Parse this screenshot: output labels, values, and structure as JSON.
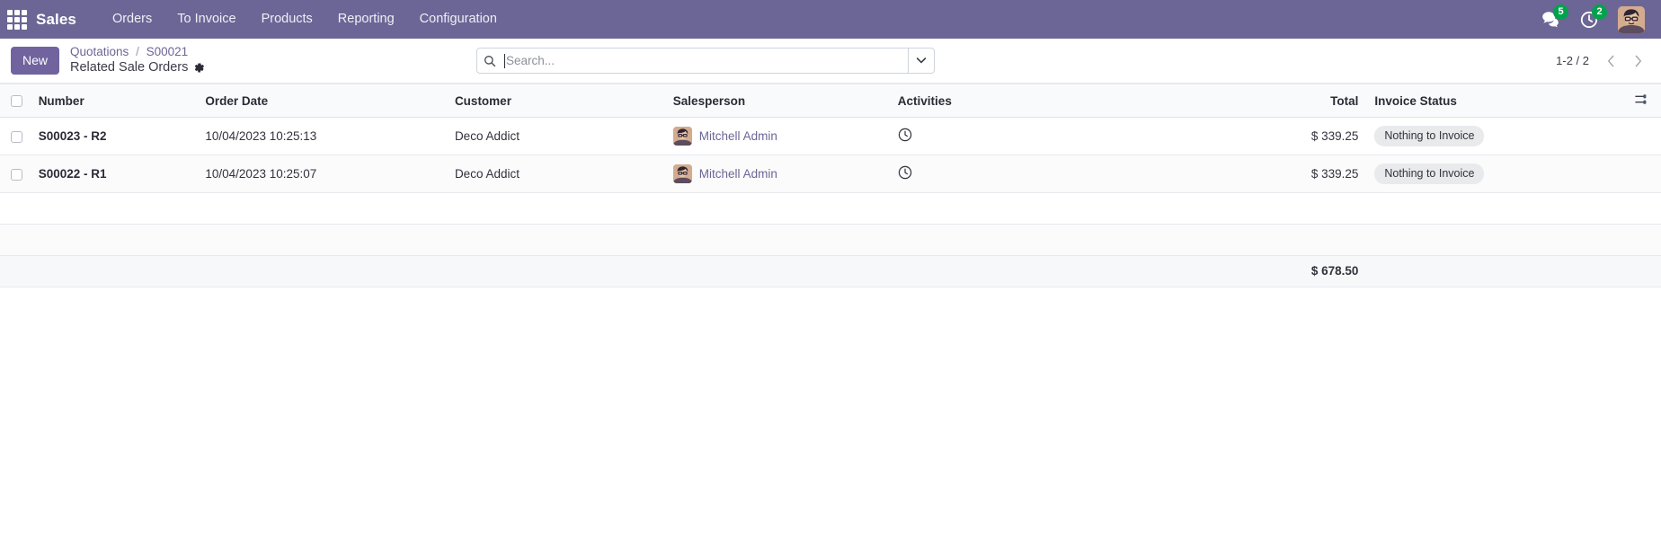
{
  "navbar": {
    "apps_icon": "apps-grid-icon",
    "brand": "Sales",
    "menu": [
      {
        "label": "Orders"
      },
      {
        "label": "To Invoice"
      },
      {
        "label": "Products"
      },
      {
        "label": "Reporting"
      },
      {
        "label": "Configuration"
      }
    ],
    "messages_icon": "messages-icon",
    "messages_count": "5",
    "activities_icon": "clock-activities-icon",
    "activities_count": "2",
    "avatar_icon": "user-avatar",
    "background_color": "#6b6695",
    "badge_color": "#00a34b"
  },
  "control_panel": {
    "new_label": "New",
    "breadcrumb": {
      "parent": "Quotations",
      "separator": "/",
      "record": "S00021",
      "title": "Related Sale Orders",
      "gear_icon": "gear-icon"
    },
    "search": {
      "icon": "search-icon",
      "placeholder": "Search...",
      "value": "",
      "dropdown_icon": "chevron-down-icon"
    },
    "pager": {
      "value": "1-2 / 2",
      "prev_icon": "chevron-left-icon",
      "next_icon": "chevron-right-icon"
    }
  },
  "list": {
    "columns": [
      {
        "key": "number",
        "label": "Number"
      },
      {
        "key": "order_date",
        "label": "Order Date"
      },
      {
        "key": "customer",
        "label": "Customer"
      },
      {
        "key": "salesperson",
        "label": "Salesperson"
      },
      {
        "key": "activities",
        "label": "Activities"
      },
      {
        "key": "total",
        "label": "Total"
      },
      {
        "key": "invoice_status",
        "label": "Invoice Status"
      }
    ],
    "optional_columns_icon": "column-settings-icon",
    "rows": [
      {
        "number": "S00023 - R2",
        "order_date": "10/04/2023 10:25:13",
        "customer": "Deco Addict",
        "salesperson": "Mitchell Admin",
        "activities_icon": "clock-icon",
        "total": "$ 339.25",
        "invoice_status": "Nothing to Invoice"
      },
      {
        "number": "S00022 - R1",
        "order_date": "10/04/2023 10:25:07",
        "customer": "Deco Addict",
        "salesperson": "Mitchell Admin",
        "activities_icon": "clock-icon",
        "total": "$ 339.25",
        "invoice_status": "Nothing to Invoice"
      }
    ],
    "footer": {
      "total": "$ 678.50"
    }
  }
}
